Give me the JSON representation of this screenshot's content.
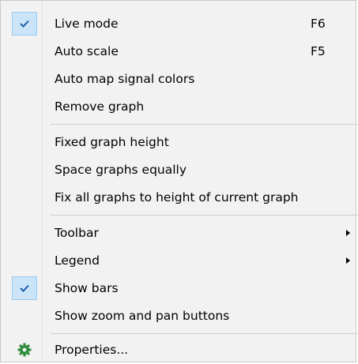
{
  "menu": {
    "items": [
      {
        "label": "Live mode",
        "shortcut": "F6",
        "checked": true
      },
      {
        "label": "Auto scale",
        "shortcut": "F5",
        "checked": false
      },
      {
        "label": "Auto map signal colors",
        "checked": false
      },
      {
        "label": "Remove graph",
        "checked": false
      },
      {
        "label": "Fixed graph height",
        "checked": false
      },
      {
        "label": "Space graphs equally",
        "checked": false
      },
      {
        "label": "Fix all graphs to height of current graph",
        "checked": false
      },
      {
        "label": "Toolbar",
        "submenu": true,
        "checked": false
      },
      {
        "label": "Legend",
        "submenu": true,
        "checked": false
      },
      {
        "label": "Show bars",
        "checked": true
      },
      {
        "label": "Show zoom and pan buttons",
        "checked": false
      },
      {
        "label": "Properties...",
        "icon": "gear-icon",
        "checked": false
      }
    ]
  },
  "colors": {
    "menu_background": "#f2f2f2",
    "check_highlight": "#cce4f7",
    "check_mark": "#1a5fa8",
    "gear": "#2e8b3a"
  }
}
